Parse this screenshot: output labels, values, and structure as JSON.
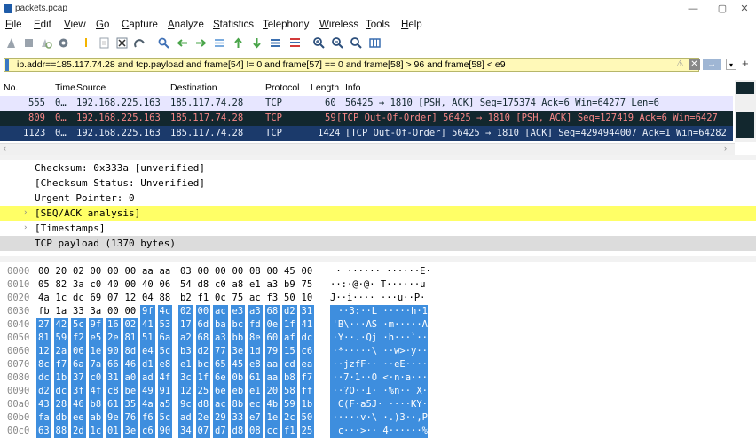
{
  "window": {
    "title": "packets.pcap",
    "minimize": "—",
    "restore": "▢",
    "close": "✕"
  },
  "menu": [
    "File",
    "Edit",
    "View",
    "Go",
    "Capture",
    "Analyze",
    "Statistics",
    "Telephony",
    "Wireless",
    "Tools",
    "Help"
  ],
  "toolbar_icons": [
    "shark-fin-start-icon",
    "stop-icon",
    "restart-icon",
    "options-gear-icon",
    "open-folder-icon",
    "save-file-icon",
    "close-file-icon",
    "reload-icon",
    "find-icon",
    "back-arrow-icon",
    "forward-arrow-icon",
    "go-to-packet-icon",
    "first-packet-icon",
    "last-packet-icon",
    "autoscroll-icon",
    "colorize-icon",
    "zoom-in-icon",
    "zoom-out-icon",
    "normal-size-icon",
    "resize-columns-icon"
  ],
  "filter": {
    "value": "ip.addr==185.117.74.28 and tcp.payload and frame[54] != 0 and frame[57] == 0 and frame[58] > 96 and frame[58] < e9",
    "clear_icon": "clear-filter-icon",
    "apply_icon": "apply-filter-arrow-icon",
    "dropdown_icon": "chevron-down-icon",
    "add_icon": "plus-icon"
  },
  "packet_list": {
    "columns": [
      "No.",
      "Time",
      "Source",
      "Destination",
      "Protocol",
      "Length",
      "Info"
    ],
    "rows": [
      {
        "no": "555",
        "time": "0…",
        "src": "192.168.225.163",
        "dst": "185.117.74.28",
        "proto": "TCP",
        "len": "60",
        "info": "56425 → 1810 [PSH, ACK] Seq=175374 Ack=6 Win=64277 Len=6",
        "bg": "#e7e6ff",
        "fg": "#12272e"
      },
      {
        "no": "809",
        "time": "0…",
        "src": "192.168.225.163",
        "dst": "185.117.74.28",
        "proto": "TCP",
        "len": "59",
        "info": "[TCP Out-Of-Order] 56425 → 1810 [PSH, ACK] Seq=127419 Ack=6 Win=6427",
        "bg": "#12272e",
        "fg": "#f78787"
      },
      {
        "no": "1123",
        "time": "0…",
        "src": "192.168.225.163",
        "dst": "185.117.74.28",
        "proto": "TCP",
        "len": "1424",
        "info": "[TCP Out-Of-Order] 56425 → 1810 [ACK] Seq=4294944007 Ack=1 Win=64282",
        "bg": "#1b3a6b",
        "fg": "#e8eef8"
      }
    ]
  },
  "details": [
    {
      "text": "Checksum: 0x333a [unverified]",
      "arrow": ""
    },
    {
      "text": "[Checksum Status: Unverified]",
      "arrow": ""
    },
    {
      "text": "Urgent Pointer: 0",
      "arrow": ""
    },
    {
      "text": "[SEQ/ACK analysis]",
      "arrow": "›",
      "highlight": "#ffff66"
    },
    {
      "text": "[Timestamps]",
      "arrow": "›"
    },
    {
      "text": "TCP payload (1370 bytes)",
      "arrow": "",
      "highlight": "#dcdcdc"
    }
  ],
  "hex_dump": [
    {
      "off": "0000",
      "bytes": [
        "00",
        "20",
        "02",
        "00",
        "00",
        "00",
        "aa",
        "aa",
        "03",
        "00",
        "00",
        "00",
        "08",
        "00",
        "45",
        "00"
      ],
      "ascii": " · ······ ······E·",
      "sel_from": 16
    },
    {
      "off": "0010",
      "bytes": [
        "05",
        "82",
        "3a",
        "c0",
        "40",
        "00",
        "40",
        "06",
        "54",
        "d8",
        "c0",
        "a8",
        "e1",
        "a3",
        "b9",
        "75"
      ],
      "ascii": "··:·@·@· T······u",
      "sel_from": 16
    },
    {
      "off": "0020",
      "bytes": [
        "4a",
        "1c",
        "dc",
        "69",
        "07",
        "12",
        "04",
        "88",
        "b2",
        "f1",
        "0c",
        "75",
        "ac",
        "f3",
        "50",
        "10"
      ],
      "ascii": "J··i···· ···u··P·",
      "sel_from": 16
    },
    {
      "off": "0030",
      "bytes": [
        "fb",
        "1a",
        "33",
        "3a",
        "00",
        "00",
        "9f",
        "4c",
        "02",
        "00",
        "ac",
        "e3",
        "a3",
        "68",
        "d2",
        "31"
      ],
      "ascii": "··3:··L ·····h·1",
      "sel_from": 6
    },
    {
      "off": "0040",
      "bytes": [
        "27",
        "42",
        "5c",
        "9f",
        "16",
        "02",
        "41",
        "53",
        "17",
        "6d",
        "ba",
        "bc",
        "fd",
        "0e",
        "1f",
        "41"
      ],
      "ascii": "'B\\···AS ·m·····A",
      "sel_from": 0
    },
    {
      "off": "0050",
      "bytes": [
        "81",
        "59",
        "f2",
        "e5",
        "2e",
        "81",
        "51",
        "6a",
        "a2",
        "68",
        "a3",
        "bb",
        "8e",
        "60",
        "af",
        "dc"
      ],
      "ascii": "·Y··.·Qj ·h···`··",
      "sel_from": 0
    },
    {
      "off": "0060",
      "bytes": [
        "12",
        "2a",
        "06",
        "1e",
        "90",
        "8d",
        "e4",
        "5c",
        "b3",
        "d2",
        "77",
        "3e",
        "1d",
        "79",
        "15",
        "c6"
      ],
      "ascii": "·*·····\\ ··w>·y··",
      "sel_from": 0
    },
    {
      "off": "0070",
      "bytes": [
        "8c",
        "f7",
        "6a",
        "7a",
        "66",
        "46",
        "d1",
        "e8",
        "e1",
        "bc",
        "65",
        "45",
        "e8",
        "aa",
        "cd",
        "ea"
      ],
      "ascii": "··jzfF·· ··eE····",
      "sel_from": 0
    },
    {
      "off": "0080",
      "bytes": [
        "dc",
        "1b",
        "37",
        "c0",
        "31",
        "a0",
        "ad",
        "4f",
        "3c",
        "1f",
        "6e",
        "0b",
        "61",
        "aa",
        "b8",
        "f7"
      ],
      "ascii": "··7·1··O <·n·a···",
      "sel_from": 0
    },
    {
      "off": "0090",
      "bytes": [
        "d2",
        "dc",
        "3f",
        "4f",
        "c8",
        "be",
        "49",
        "91",
        "12",
        "25",
        "6e",
        "eb",
        "e1",
        "20",
        "58",
        "ff"
      ],
      "ascii": "··?O··I· ·%n·· X·",
      "sel_from": 0
    },
    {
      "off": "00a0",
      "bytes": [
        "43",
        "28",
        "46",
        "b8",
        "61",
        "35",
        "4a",
        "a5",
        "9c",
        "d8",
        "ac",
        "8b",
        "ec",
        "4b",
        "59",
        "1b"
      ],
      "ascii": "C(F·a5J· ····KY·",
      "sel_from": 0
    },
    {
      "off": "00b0",
      "bytes": [
        "fa",
        "db",
        "ee",
        "ab",
        "9e",
        "76",
        "f6",
        "5c",
        "ad",
        "2e",
        "29",
        "33",
        "e7",
        "1e",
        "2c",
        "50"
      ],
      "ascii": "·····v·\\ ·.)3··,P",
      "sel_from": 0
    },
    {
      "off": "00c0",
      "bytes": [
        "63",
        "88",
        "2d",
        "1c",
        "01",
        "3e",
        "c6",
        "90",
        "34",
        "07",
        "d7",
        "d8",
        "08",
        "cc",
        "f1",
        "25"
      ],
      "ascii": "c···>·· 4······%",
      "sel_from": 0
    }
  ]
}
